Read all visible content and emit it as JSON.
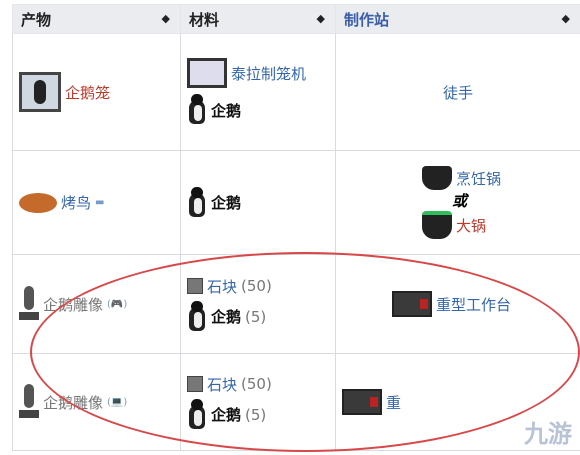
{
  "headers": {
    "product": "产物",
    "materials": "材料",
    "station": "制作站",
    "sort": "◆"
  },
  "rows": [
    {
      "product": "企鹅笼",
      "materials": [
        {
          "name": "泰拉制笼机",
          "qty": ""
        },
        {
          "name": "企鹅",
          "qty": ""
        }
      ],
      "station": "徒手"
    },
    {
      "product": "烤鸟",
      "materials": [
        {
          "name": "企鹅",
          "qty": ""
        }
      ],
      "station_a": "烹饪锅",
      "or": "或",
      "station_b": "大锅"
    },
    {
      "product": "企鹅雕像",
      "suffix": "(🎮)",
      "materials": [
        {
          "name": "石块",
          "qty": "(50)"
        },
        {
          "name": "企鹅",
          "qty": "(5)"
        }
      ],
      "station": "重型工作台"
    },
    {
      "product": "企鹅雕像",
      "suffix": "(💻)",
      "materials": [
        {
          "name": "石块",
          "qty": "(50)"
        },
        {
          "name": "企鹅",
          "qty": "(5)"
        }
      ],
      "station": "重"
    }
  ],
  "watermark": "九游"
}
